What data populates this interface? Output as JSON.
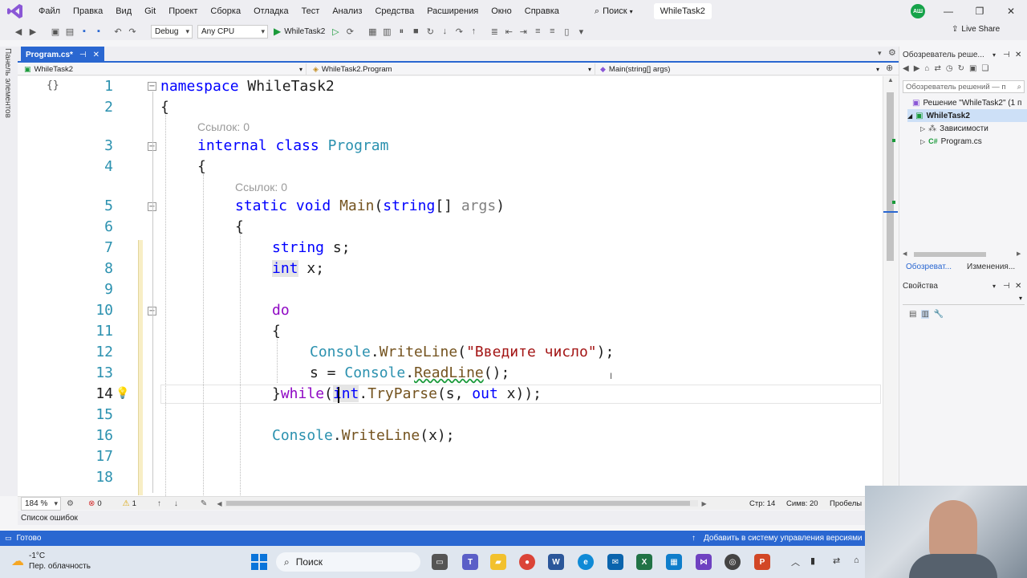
{
  "menubar": {
    "items": [
      "Файл",
      "Правка",
      "Вид",
      "Git",
      "Проект",
      "Сборка",
      "Отладка",
      "Тест",
      "Анализ",
      "Средства",
      "Расширения",
      "Окно",
      "Справка"
    ],
    "search_label": "Поиск",
    "solution_title": "WhileTask2",
    "avatar_initials": "АШ"
  },
  "toolbar": {
    "config": "Debug",
    "platform": "Any CPU",
    "run_target": "WhileTask2",
    "live_share": "Live Share"
  },
  "left_strip": {
    "label": "Панель элементов"
  },
  "tab": {
    "label": "Program.cs*"
  },
  "navbar": {
    "project": "WhileTask2",
    "class": "WhileTask2.Program",
    "member": "Main(string[] args)"
  },
  "editor": {
    "codelens": [
      "Ссылок: 0",
      "Ссылок: 0"
    ],
    "current_line": 14
  },
  "editor_status": {
    "zoom": "184 %",
    "errors": "0",
    "warnings": "1",
    "line": "Стр: 14",
    "col": "Симв: 20",
    "spaces": "Пробелы"
  },
  "solution_explorer": {
    "title": "Обозреватель реше...",
    "search_placeholder": "Обозреватель решений — п",
    "solution": "Решение \"WhileTask2\" (1 п",
    "project": "WhileTask2",
    "dependencies": "Зависимости",
    "file": "Program.cs",
    "tab_explorer": "Обозреват...",
    "tab_changes": "Изменения..."
  },
  "properties": {
    "title": "Свойства"
  },
  "error_list": {
    "label": "Список ошибок"
  },
  "statusbar": {
    "ready": "Готово",
    "add_vcs": "Добавить в систему управления версиями"
  },
  "taskbar": {
    "weather_temp": "-1°C",
    "weather_desc": "Пер. облачность",
    "search_label": "Поиск"
  },
  "colors": {
    "accent": "#2a67d1",
    "keyword": "#0000ff",
    "type": "#2b91af",
    "string": "#a31515"
  }
}
